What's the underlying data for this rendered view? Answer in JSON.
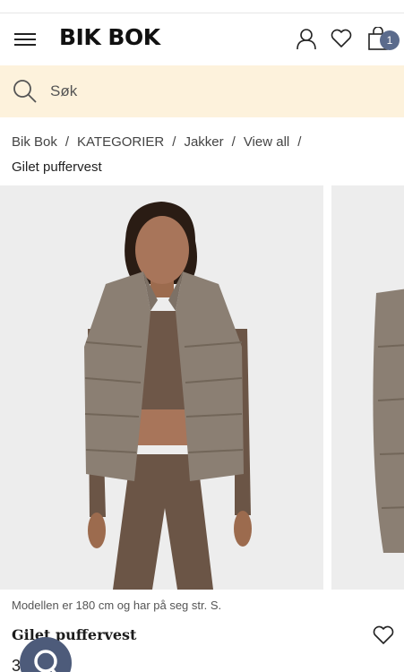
{
  "header": {
    "logo": "BIK BOK",
    "cart_count": "1",
    "icons": [
      "menu-icon",
      "user-icon",
      "heart-icon",
      "bag-icon"
    ]
  },
  "search": {
    "placeholder": "Søk"
  },
  "breadcrumb": {
    "items": [
      "Bik Bok",
      "KATEGORIER",
      "Jakker",
      "View all"
    ],
    "current": "Gilet puffervest"
  },
  "product": {
    "model_info": "Modellen er 180 cm og har på seg str. S.",
    "name": "Gilet puffervest",
    "price_partial": "3"
  },
  "colors": {
    "search_bg": "#fdf2dc",
    "badge": "#5b6b8c",
    "chat": "#4d5b7a",
    "vest": "#8b7f73",
    "top": "#6b5546"
  }
}
